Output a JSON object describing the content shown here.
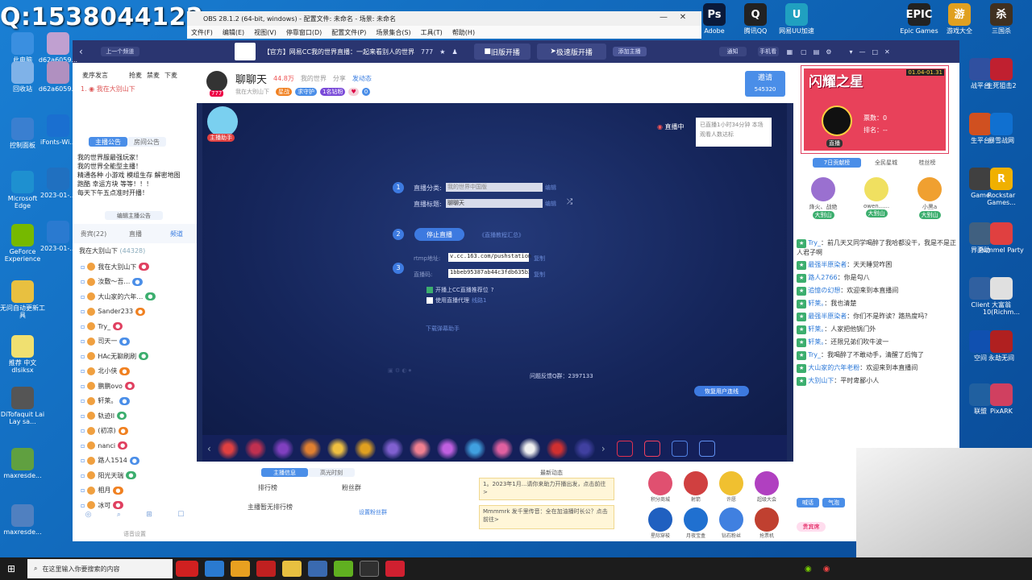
{
  "desktop": {
    "qq_number": "Q:1538044122",
    "icons_left": [
      {
        "label": "此电脑",
        "color": "#3a8fe0"
      },
      {
        "label": "回收站",
        "color": "#7fb2e8"
      },
      {
        "label": "控制面板",
        "color": "#3a7fd0"
      },
      {
        "label": "Microsoft Edge",
        "color": "#1e90d0"
      },
      {
        "label": "GeForce Experience",
        "color": "#76b900"
      },
      {
        "label": "无问自动更新工具",
        "color": "#e8c040"
      },
      {
        "label": "推荐 中文dlsiksx",
        "color": "#f0e070"
      },
      {
        "label": "DiTofaquit Lai Lay sa...",
        "color": "#555"
      },
      {
        "label": "maxresde...",
        "color": "#60a040"
      },
      {
        "label": "maxresde...",
        "color": "#5080c0"
      }
    ],
    "icons_left2": [
      {
        "label": "d62a6059...",
        "color": "#c0a0d0"
      },
      {
        "label": "d62a6059...",
        "color": "#b090c0"
      },
      {
        "label": "iFonts-Wi...",
        "color": "#1a6fd0"
      },
      {
        "label": "2023-01-...",
        "color": "#2070c0"
      },
      {
        "label": "2023-01-...",
        "color": "#2a7ad0"
      }
    ],
    "icons_top": [
      {
        "label": "Adobe",
        "text": "Ps",
        "color": "#0a1a3a"
      },
      {
        "label": "腾讯QQ",
        "text": "Q",
        "color": "#222"
      },
      {
        "label": "网易UU加速",
        "text": "U",
        "color": "#20a0c0"
      }
    ],
    "icons_right": [
      {
        "label": "Epic Games",
        "text": "EPIC",
        "color": "#222"
      },
      {
        "label": "游戏大全",
        "text": "游",
        "color": "#e0a020"
      },
      {
        "label": "三国杀",
        "text": "杀",
        "color": "#403020"
      },
      {
        "label": "战平台",
        "text": "",
        "color": "#3050a0"
      },
      {
        "label": "生死狙击2",
        "text": "",
        "color": "#c02030"
      },
      {
        "label": "生平台",
        "text": "",
        "color": "#d05020"
      },
      {
        "label": "暴雪战网",
        "text": "",
        "color": "#1070d0"
      },
      {
        "label": "Game",
        "text": "",
        "color": "#404040"
      },
      {
        "label": "Rockstar Games...",
        "text": "R",
        "color": "#f0b000"
      },
      {
        "label": "界面助",
        "text": "",
        "color": "#406080"
      },
      {
        "label": "Pummel Party",
        "text": "",
        "color": "#e04040"
      },
      {
        "label": "Client",
        "text": "",
        "color": "#3060a0"
      },
      {
        "label": "大富翁10(Richm...",
        "text": "",
        "color": "#e0e0e0"
      },
      {
        "label": "空间",
        "text": "",
        "color": "#1050b0"
      },
      {
        "label": "永劫无间",
        "text": "",
        "color": "#b02020"
      },
      {
        "label": "联盟",
        "text": "",
        "color": "#2060a0"
      },
      {
        "label": "PixARK",
        "text": "",
        "color": "#d04060"
      }
    ]
  },
  "obs": {
    "title": "OBS 28.1.2 (64-bit, windows) - 配置文件: 未命名 - 场景: 未命名",
    "menu": [
      "文件(F)",
      "编辑(E)",
      "视图(V)",
      "停靠窗口(D)",
      "配置文件(P)",
      "场景集合(S)",
      "工具(T)",
      "帮助(H)"
    ]
  },
  "cc": {
    "top": {
      "prev": "上一个频道",
      "title": "【官方】网易CC我的世界直播：一起来看别人的世界",
      "fans": "777",
      "old_live": "旧版开播",
      "fast_live": "极速版开播",
      "add_anchor": "添加主播",
      "notice": "通知",
      "phone": "手机看"
    },
    "left": {
      "tabs": [
        "麦序发言",
        "抢麦",
        "禁麦",
        "下麦"
      ],
      "mic_user": "我在大别山下",
      "announce_tabs": [
        "主播公告",
        "房间公告"
      ],
      "announcement": [
        "我的世界服最强玩家！",
        "我的世界全能型主播！",
        "精通各种 小游戏 模组生存 解密地图",
        "跑酷 幸运方块 等等！！！",
        "每天下午五点准时开播！"
      ],
      "edit_announce": "编辑主播公告",
      "list_tabs": [
        "贵宾(22)",
        "直播",
        "频道"
      ],
      "room": "我在大别山下",
      "room_count": "(44328)",
      "users": [
        "我在大别山下",
        "汝敷～吾…",
        "大山家的六年…",
        "Sander233",
        "Try_",
        "司天一",
        "HAc无聊刷刷",
        "北小侠",
        "鹏鹏ovo",
        "轩莱。",
        "轨迹II",
        "(初凉)",
        "nanci",
        "路人1514",
        "阳光天瑞",
        "相月",
        "冰可"
      ],
      "footer": "语音设置"
    },
    "header": {
      "name": "聊聊天",
      "heat": "44.8万",
      "game": "我的世界",
      "share": "分享",
      "dynamic": "发动态",
      "fans_count": "777",
      "badge1": "我在大别山下",
      "badge2": "星战",
      "badge3": "求守护",
      "badge4": "1名钻粉",
      "badge5": "0",
      "invite": "邀请",
      "invite_num": "545320"
    },
    "stage": {
      "assistant": "主播助手",
      "status": "直播中",
      "status_note": "已直播1小时34分钟 本场观看人数达标",
      "step1_label1": "直播分类:",
      "step1_value1": "我的世界中国版",
      "step1_edit": "编辑",
      "step1_label2": "直播标题:",
      "step1_value2": "聊聊天",
      "step2_btn": "停止直播",
      "step2_link": "《直播教程汇总》",
      "rtmp_label": "rtmp地址:",
      "rtmp_value": "v.cc.163.com/pushstation",
      "stream_label": "直播码:",
      "stream_value": "1bbeb95387ab44c3fdb635b3",
      "copy": "复制",
      "check1": "开播上CC直播推荐位",
      "check2": "使用直播代理",
      "check2_link": "线路1",
      "download": "下载弹幕助手",
      "feedback": "问题反馈Q群：2397133",
      "switch": "恢复用户连线"
    },
    "bottom": {
      "tabs": [
        "主播信息",
        "高光时刻"
      ],
      "rank": "排行榜",
      "fans_group": "粉丝群",
      "no_rank": "主播暂无排行榜",
      "set_fans": "设置粉丝群",
      "news": "最新动态",
      "news1": "1。2023年1月...请你来助力开播出发，点击前往>",
      "news2": "Mmmmrk 发千里传音：全在加油播时长公？点击前往>",
      "actions": [
        "积分商城",
        "射箭",
        "许愿",
        "超级大会",
        "星际穿梭",
        "月夜宝盒",
        "钻石粉丝",
        "抢票机"
      ]
    },
    "right": {
      "event": "闪耀之星",
      "event_date": "01.04-01.31",
      "votes": "票数：0",
      "rank": "排名：--",
      "status": "直播",
      "tabs": [
        "7日贡献榜",
        "全民星城",
        "桂丝榜"
      ],
      "top3": [
        {
          "name": "烽火、战绝",
          "badge": "大别山"
        },
        {
          "name": "owen......",
          "badge": "大别山"
        },
        {
          "name": "小黑a",
          "badge": "大别山"
        }
      ],
      "chat": [
        {
          "user": "Try_",
          "text": "前几天又同学喝醉了我哈都没干，我是不是正人君子啊"
        },
        {
          "user": "最强半原染者",
          "text": "天天睡觉咋困"
        },
        {
          "user": "路人2766",
          "text": "你是勾八"
        },
        {
          "user": "追憶の幻想",
          "text": "欢迎来到本直播间"
        },
        {
          "user": "轩莱。",
          "text": "我也清楚"
        },
        {
          "user": "最强半原染者",
          "text": "你们不是昨读？踏热度吗？"
        },
        {
          "user": "轩莱。",
          "text": "人家把他锅门外"
        },
        {
          "user": "轩莱。",
          "text": "还限兄弟们吹牛波一"
        },
        {
          "user": "Try_",
          "text": "我喝醉了不敢动手，清醒了后悔了"
        },
        {
          "user": "大山家的六年老粉",
          "text": "欢迎来到本直播间"
        },
        {
          "user": "大别山下",
          "text": "平时卑鄙小人"
        }
      ],
      "btns": [
        "喊话",
        "气泡"
      ],
      "vip": "贵宾席"
    }
  },
  "taskbar": {
    "search": "在这里输入你要搜索的内容"
  }
}
